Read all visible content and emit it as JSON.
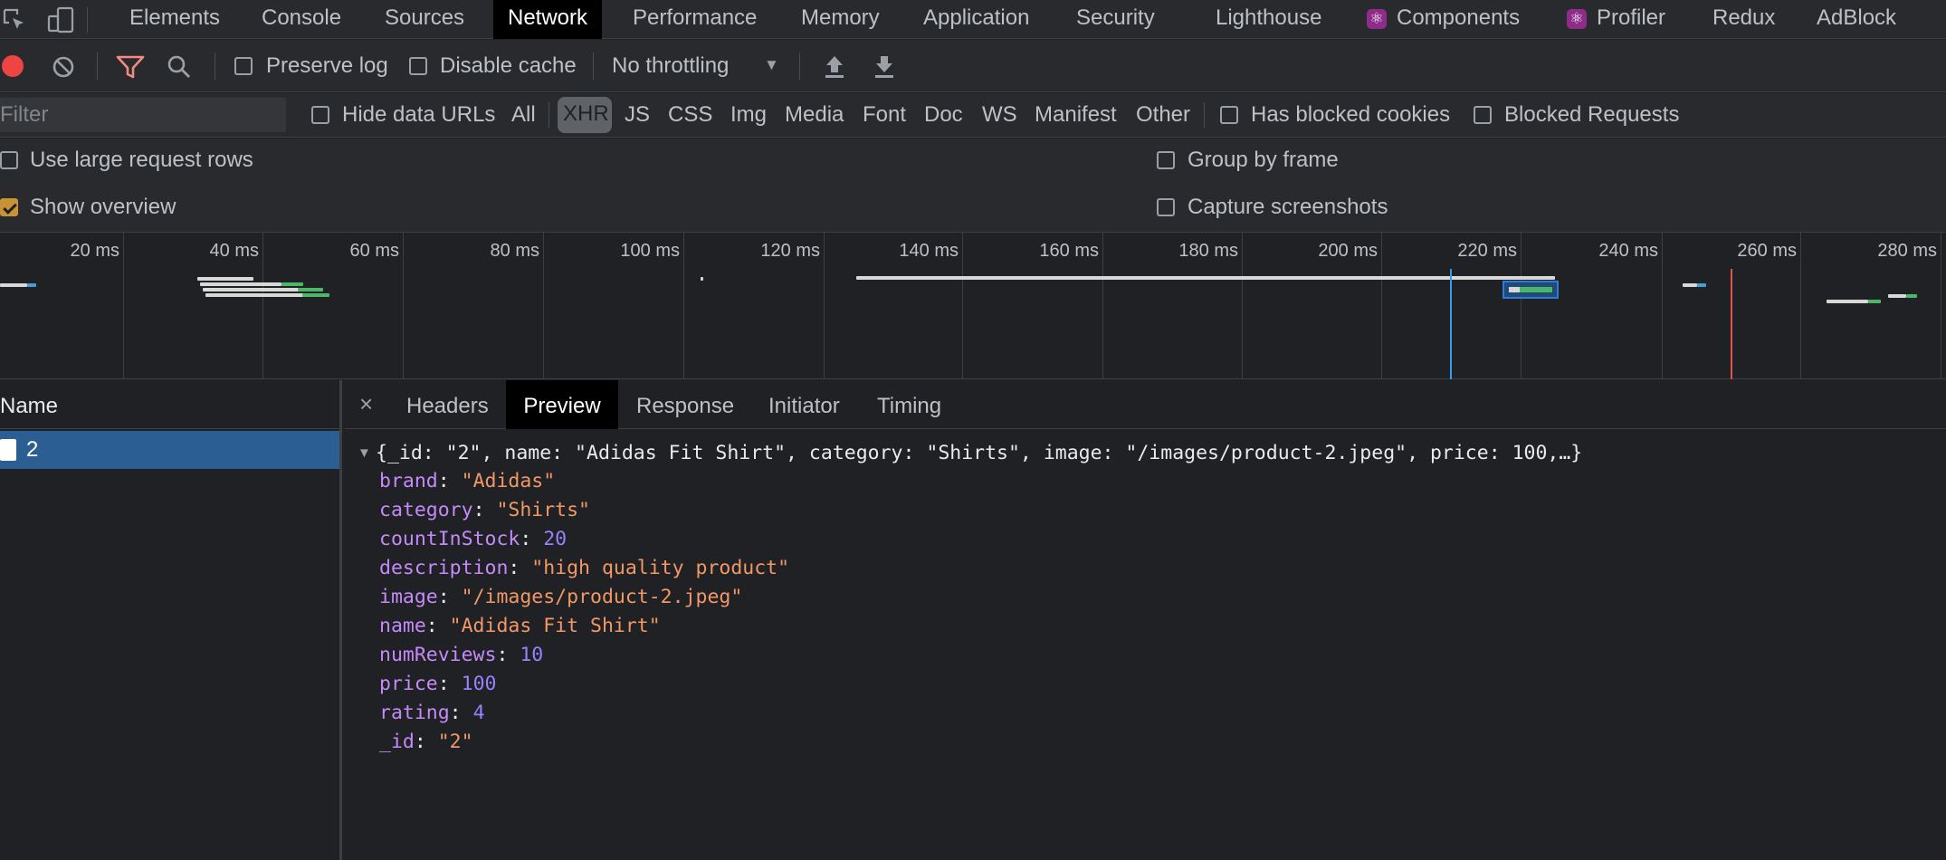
{
  "tabs": [
    "Elements",
    "Console",
    "Sources",
    "Network",
    "Performance",
    "Memory",
    "Application",
    "Security",
    "Lighthouse",
    "Components",
    "Profiler",
    "Redux",
    "AdBlock"
  ],
  "react_icon": "⚛",
  "toolbar": {
    "preserve_log": "Preserve log",
    "disable_cache": "Disable cache",
    "throttling": "No throttling",
    "throttling_caret": "▼"
  },
  "filter": {
    "placeholder": "Filter",
    "hide_data_urls": "Hide data URLs",
    "types": [
      "All",
      "XHR",
      "JS",
      "CSS",
      "Img",
      "Media",
      "Font",
      "Doc",
      "WS",
      "Manifest",
      "Other"
    ],
    "active_type": "XHR",
    "has_blocked_cookies": "Has blocked cookies",
    "blocked_requests": "Blocked Requests"
  },
  "settings": {
    "use_large_rows": "Use large request rows",
    "group_by_frame": "Group by frame",
    "show_overview": "Show overview",
    "capture_screenshots": "Capture screenshots"
  },
  "overview": {
    "ticks": [
      "20 ms",
      "40 ms",
      "60 ms",
      "80 ms",
      "100 ms",
      "120 ms",
      "140 ms",
      "160 ms",
      "180 ms",
      "200 ms",
      "220 ms",
      "240 ms",
      "260 ms",
      "280 ms"
    ]
  },
  "requests": {
    "header": "Name",
    "rows": [
      {
        "name": "2"
      }
    ]
  },
  "detail": {
    "close": "×",
    "tabs": [
      "Headers",
      "Preview",
      "Response",
      "Initiator",
      "Timing"
    ],
    "active_tab": "Preview",
    "summary_arrow": "▼",
    "summary": "{_id: \"2\", name: \"Adidas Fit Shirt\", category: \"Shirts\", image: \"/images/product-2.jpeg\", price: 100,…}",
    "fields": [
      {
        "key": "brand",
        "value": "\"Adidas\"",
        "kind": "string"
      },
      {
        "key": "category",
        "value": "\"Shirts\"",
        "kind": "string"
      },
      {
        "key": "countInStock",
        "value": "20",
        "kind": "number"
      },
      {
        "key": "description",
        "value": "\"high quality product\"",
        "kind": "string"
      },
      {
        "key": "image",
        "value": "\"/images/product-2.jpeg\"",
        "kind": "string"
      },
      {
        "key": "name",
        "value": "\"Adidas Fit Shirt\"",
        "kind": "string"
      },
      {
        "key": "numReviews",
        "value": "10",
        "kind": "number"
      },
      {
        "key": "price",
        "value": "100",
        "kind": "number"
      },
      {
        "key": "rating",
        "value": "4",
        "kind": "number"
      },
      {
        "key": "_id",
        "value": "\"2\"",
        "kind": "string"
      }
    ]
  }
}
